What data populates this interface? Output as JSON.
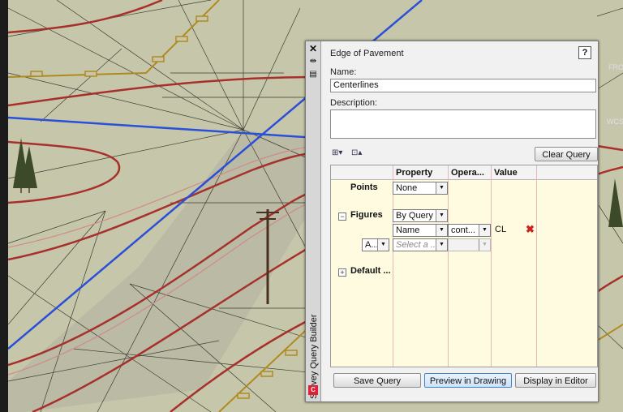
{
  "viewport": {
    "cube_labels": [
      "FRO",
      "WCS"
    ],
    "colors": {
      "background": "#c6c7aa",
      "road_edge": "#a8302c",
      "blue_line": "#2a4fd8",
      "gold_line": "#b08a20",
      "triangles": "#3a3a3a"
    }
  },
  "palette": {
    "vertical_title": "Survey Query Builder",
    "title_icons": {
      "close": "close-icon",
      "pin": "autohide-icon",
      "props": "properties-icon"
    },
    "query_name_label": "Edge of Pavement",
    "help_label": "?",
    "name_label": "Name:",
    "name_value": "Centerlines",
    "description_label": "Description:",
    "description_value": "",
    "clear_query_label": "Clear Query",
    "grid": {
      "headers": {
        "property": "Property",
        "operator": "Opera...",
        "value": "Value"
      },
      "points": {
        "label": "Points",
        "property": "None"
      },
      "figures": {
        "label": "Figures",
        "expander": "−",
        "property": "By Query",
        "condition": {
          "property": "Name",
          "operator": "cont...",
          "value": "CL"
        },
        "new_row": {
          "andor": "A...",
          "property_placeholder": "Select a ..."
        }
      },
      "defaults": {
        "label": "Default ...",
        "expander": "+"
      }
    },
    "buttons": {
      "save": "Save Query",
      "preview": "Preview in Drawing",
      "display": "Display in Editor"
    }
  }
}
